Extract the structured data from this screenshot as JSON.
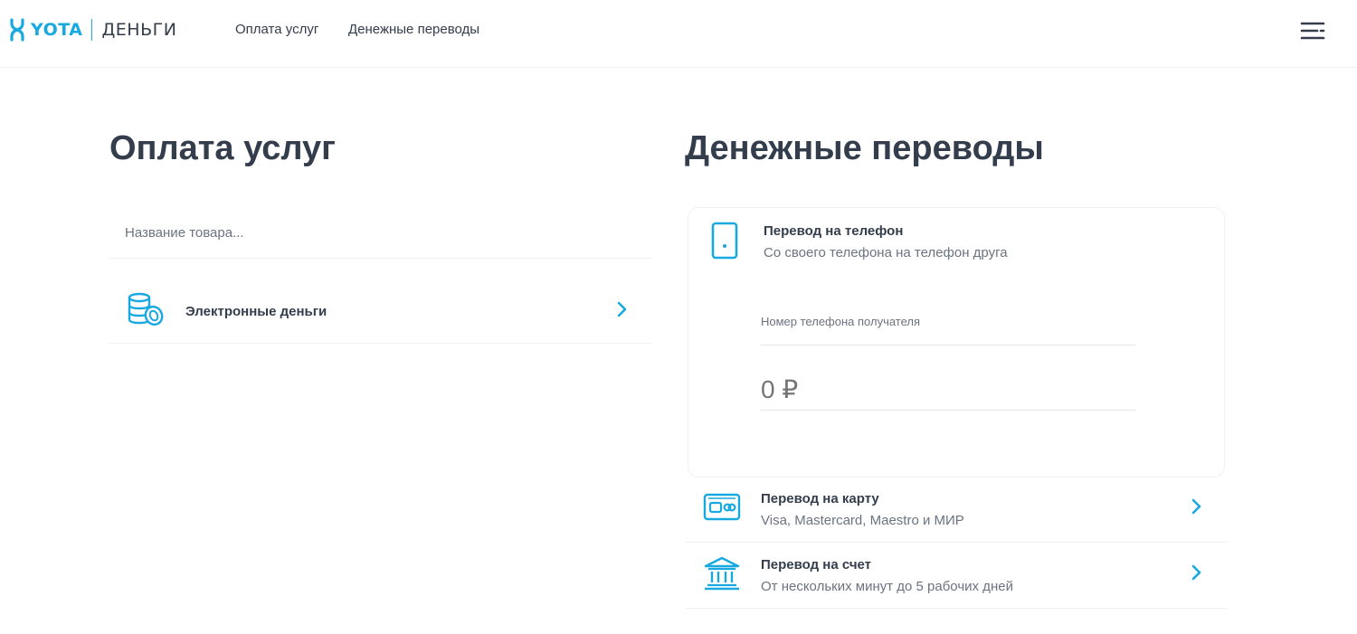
{
  "header": {
    "logo_brand": "YOTA",
    "logo_product": "ДЕНЬГИ",
    "nav": [
      "Оплата услуг",
      "Денежные переводы"
    ],
    "menu_icon": "hamburger-menu-icon"
  },
  "colors": {
    "accent": "#19a9e1",
    "text": "#333d4c",
    "muted": "#6b7380",
    "divider": "#eef0f3"
  },
  "services": {
    "title": "Оплата услуг",
    "search_placeholder": "Название товара...",
    "items": [
      {
        "label": "Электронные деньги",
        "icon": "coins-icon"
      }
    ]
  },
  "transfers": {
    "title": "Денежные переводы",
    "phone_card": {
      "title": "Перевод на телефон",
      "subtitle": "Со своего телефона на телефон друга",
      "icon": "phone-icon",
      "phone_label": "Номер телефона получателя",
      "amount_placeholder": "0 ₽"
    },
    "items": [
      {
        "title": "Перевод на карту",
        "subtitle": "Visa, Mastercard, Maestro и МИР",
        "icon": "bank-card-icon"
      },
      {
        "title": "Перевод на счет",
        "subtitle": "От нескольких минут до 5 рабочих дней",
        "icon": "bank-building-icon"
      }
    ]
  }
}
